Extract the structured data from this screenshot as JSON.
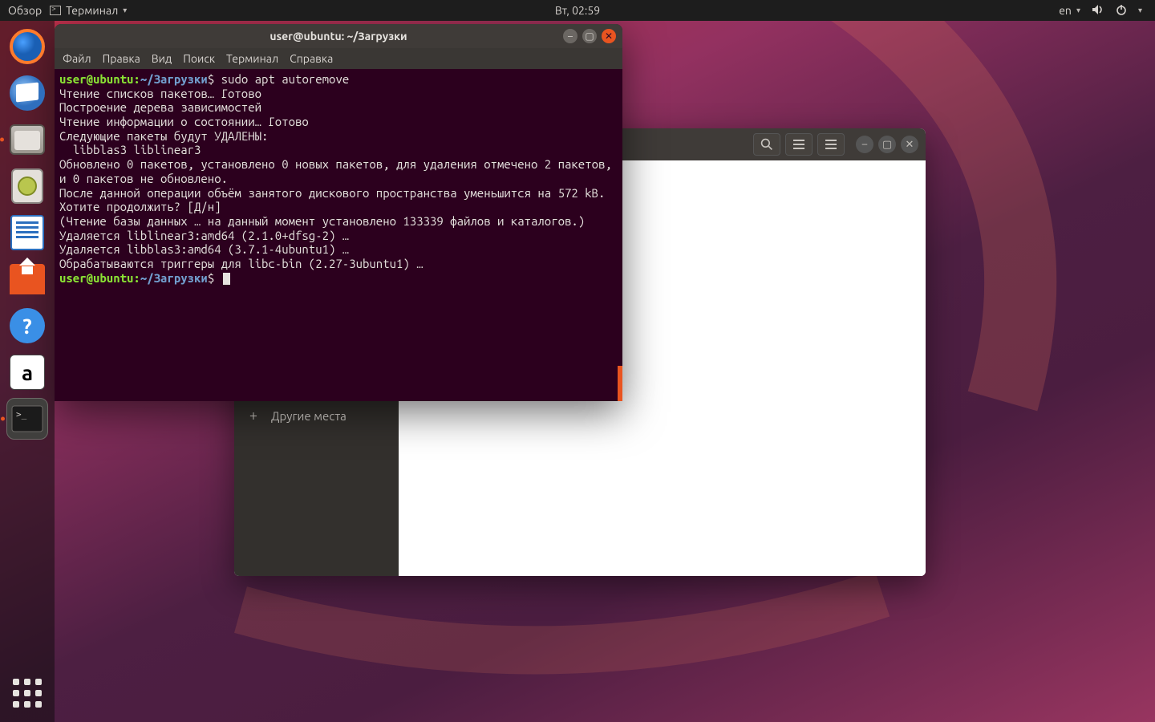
{
  "top_panel": {
    "activities": "Обзор",
    "app_indicator": "Терминал",
    "clock": "Вт, 02:59",
    "lang": "en"
  },
  "dock": {
    "help_glyph": "?",
    "amazon_glyph": "a"
  },
  "files_window": {
    "sidebar_row_label": "Другие места"
  },
  "terminal": {
    "title": "user@ubuntu: ~/Загрузки",
    "menu": {
      "file": "Файл",
      "edit": "Правка",
      "view": "Вид",
      "search": "Поиск",
      "terminal": "Терминал",
      "help": "Справка"
    },
    "prompt_user": "user@ubuntu",
    "prompt_path": "~/Загрузки",
    "dollar": "$",
    "command": "sudo apt autoremove",
    "lines": {
      "l1": "Чтение списков пакетов… Готово",
      "l2": "Построение дерева зависимостей",
      "l3": "Чтение информации о состоянии… Готово",
      "l4": "Следующие пакеты будут УДАЛЕНЫ:",
      "l5": "  libblas3 liblinear3",
      "l6": "Обновлено 0 пакетов, установлено 0 новых пакетов, для удаления отмечено 2 пакетов, и 0 пакетов не обновлено.",
      "l7": "После данной операции объём занятого дискового пространства уменьшится на 572 kB.",
      "l8": "Хотите продолжить? [Д/н]",
      "l9": "(Чтение базы данных … на данный момент установлено 133339 файлов и каталогов.)",
      "l10": "Удаляется liblinear3:amd64 (2.1.0+dfsg-2) …",
      "l11": "Удаляется libblas3:amd64 (3.7.1-4ubuntu1) …",
      "l12": "Обрабатываются триггеры для libc-bin (2.27-3ubuntu1) …"
    }
  }
}
